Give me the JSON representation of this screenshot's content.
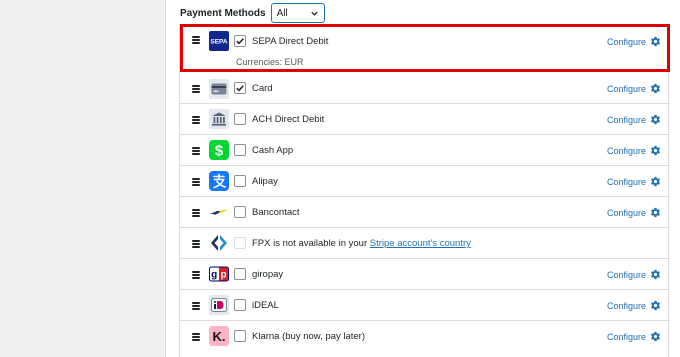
{
  "filter": {
    "label": "Payment Methods",
    "selected": "All"
  },
  "configure_label": "Configure",
  "methods": [
    {
      "name": "SEPA Direct Debit",
      "checked": true,
      "sub": "Currencies: EUR",
      "icon": "sepa-icon",
      "configurable": true
    },
    {
      "name": "Card",
      "checked": true,
      "icon": "card-icon",
      "configurable": true
    },
    {
      "name": "ACH Direct Debit",
      "checked": false,
      "icon": "bank-icon",
      "configurable": true
    },
    {
      "name": "Cash App",
      "checked": false,
      "icon": "cash-app-icon",
      "configurable": true
    },
    {
      "name": "Alipay",
      "checked": false,
      "icon": "alipay-icon",
      "configurable": true
    },
    {
      "name": "Bancontact",
      "checked": false,
      "icon": "bancontact-icon",
      "configurable": true
    },
    {
      "name": "FPX is not available in your ",
      "link": "Stripe account's country",
      "checked": false,
      "disabled": true,
      "icon": "fpx-icon",
      "configurable": false
    },
    {
      "name": "giropay",
      "checked": false,
      "icon": "giropay-icon",
      "configurable": true
    },
    {
      "name": "iDEAL",
      "checked": false,
      "icon": "ideal-icon",
      "configurable": true
    },
    {
      "name": "Klarna (buy now, pay later)",
      "checked": false,
      "icon": "klarna-icon",
      "configurable": true
    }
  ],
  "icon_text": {
    "sepa": "SEPA",
    "giropay_g": "g",
    "giropay_p": "p",
    "klarna": "K."
  },
  "colors": {
    "link": "#2271b1",
    "highlight": "#e00000",
    "sepa": "#10298e",
    "cash_app": "#00d632",
    "alipay": "#1677ff",
    "ideal": "#cc0066",
    "klarna": "#ffb3c7"
  }
}
